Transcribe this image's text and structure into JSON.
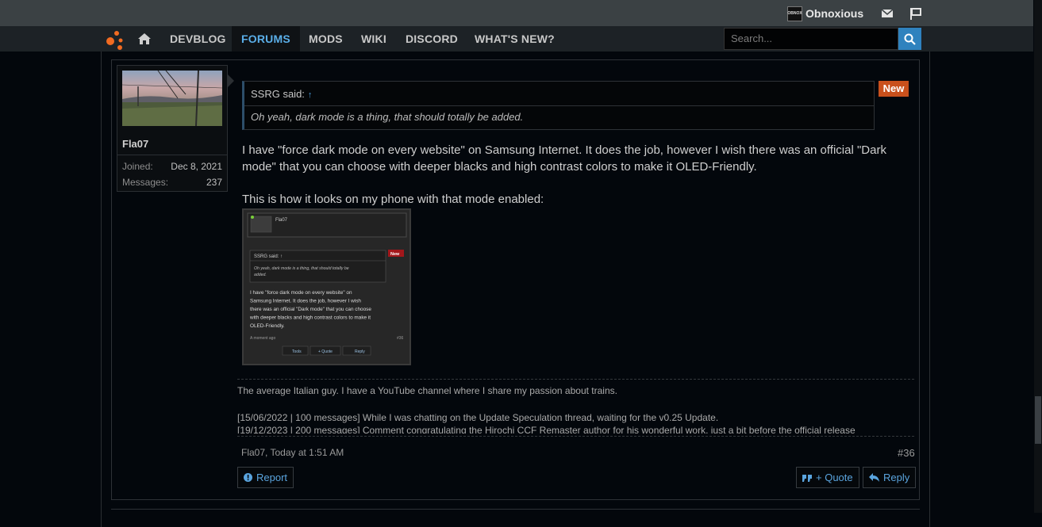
{
  "topbar": {
    "username": "Obnoxious",
    "avatar_text": "OBNOX"
  },
  "nav": {
    "tabs": [
      "DEVBLOG",
      "FORUMS",
      "MODS",
      "WIKI",
      "DISCORD",
      "WHAT'S NEW?"
    ],
    "active_tab": "FORUMS",
    "search_placeholder": "Search..."
  },
  "post": {
    "author": "Fla07",
    "joined_label": "Joined:",
    "joined_value": "Dec 8, 2021",
    "messages_label": "Messages:",
    "messages_value": "237",
    "badge": "New",
    "quote": {
      "author": "SSRG said:",
      "arrow": "↑",
      "text": "Oh yeah, dark mode is a thing, that should totally be added."
    },
    "paragraph_1_line_1": "I have \"force dark mode on every website\" on Samsung Internet. It does the job, however I wish there was an official \"Dark",
    "paragraph_1_line_2": "mode\" that you can choose with deeper blacks and high contrast colors to make it OLED-Friendly.",
    "paragraph_2": "This is how it looks on my phone with that mode enabled:",
    "screenshot": {
      "author": "Fla07",
      "quote_author": "SSRG said: ↑",
      "badge": "New",
      "quote_line_1": "Oh yeah, dark mode is a thing, that should totally be",
      "quote_line_2": "added.",
      "body_lines": [
        "I have \"force dark mode on every website\" on",
        "Samsung Internet. It does the job, however I wish",
        "there was an official \"Dark mode\" that you can choose",
        "with deeper blacks and high contrast colors to make it",
        "OLED-Friendly."
      ],
      "time": "A moment ago",
      "number": "#36",
      "buttons": [
        "Tools",
        "+ Quote",
        "Reply"
      ]
    },
    "signature": {
      "line_1": "The average Italian guy. I have a YouTube channel where I share my passion about trains.",
      "line_2": "[15/06/2022 | 100 messages] While I was chatting on the Update Speculation thread, waiting for the v0.25 Update.",
      "line_3": "[19/12/2023 | 200 messages] Comment congratulating the Hirochi CCF Remaster author for his wonderful work, just a bit before the official release"
    },
    "meta": "Fla07, Today at 1:51 AM",
    "number": "#36",
    "actions": {
      "report": "Report",
      "quote": "+ Quote",
      "reply": "Reply"
    }
  },
  "colors": {
    "accent": "#5aaee8",
    "badge": "#c9501c",
    "search_button": "#2f82be",
    "logo": "#f26b21"
  }
}
